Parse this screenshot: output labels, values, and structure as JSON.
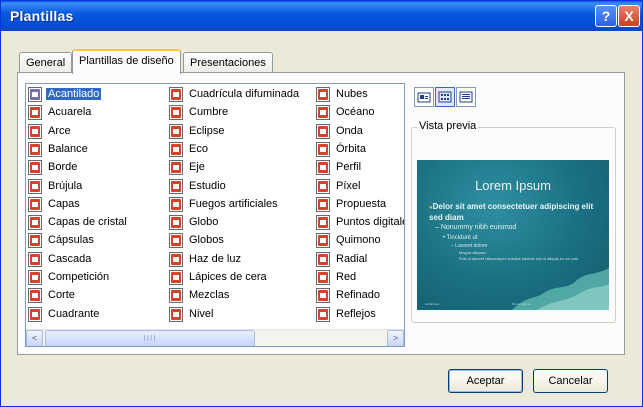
{
  "window": {
    "title": "Plantillas",
    "help_label": "?",
    "close_label": "X"
  },
  "tabs": [
    {
      "label": "General",
      "active": false
    },
    {
      "label": "Plantillas de diseño",
      "active": true
    },
    {
      "label": "Presentaciones",
      "active": false
    }
  ],
  "templates": {
    "columns": [
      [
        "Acantilado",
        "Acuarela",
        "Arce",
        "Balance",
        "Borde",
        "Brújula",
        "Capas",
        "Capas de cristal",
        "Cápsulas",
        "Cascada",
        "Competición",
        "Corte",
        "Cuadrante"
      ],
      [
        "Cuadrícula difuminada",
        "Cumbre",
        "Eclipse",
        "Eco",
        "Eje",
        "Estudio",
        "Fuegos artificiales",
        "Globo",
        "Globos",
        "Haz de luz",
        "Lápices de cera",
        "Mezclas",
        "Nivel"
      ],
      [
        "Nubes",
        "Océano",
        "Onda",
        "Órbita",
        "Perfil",
        "Píxel",
        "Propuesta",
        "Puntos digitale",
        "Quimono",
        "Radial",
        "Red",
        "Refinado",
        "Reflejos"
      ]
    ],
    "selected": "Acantilado",
    "icon": "template-icon"
  },
  "scrollbar": {
    "left_label": "<",
    "right_label": ">",
    "thumb_grip": "IIII"
  },
  "view_buttons": [
    {
      "icon": "large-icons-view-icon",
      "active": false
    },
    {
      "icon": "list-view-icon",
      "active": true
    },
    {
      "icon": "details-view-icon",
      "active": false
    }
  ],
  "preview": {
    "label": "Vista previa",
    "slide_title": "Lorem Ipsum",
    "bullets": [
      "Delor sit amet consectetuer adipiscing elit sed diam",
      "– Nonummy nibh euismod",
      "• Tincidunt ut",
      "– Laoreet dolore",
      "Magna aliquam",
      "Erat ut laoreet ullamcorper suscipit lobortis nisl ut aliquip ex ea com"
    ],
    "footer_left": "fecha/hora",
    "footer_right": "Pie de página"
  },
  "buttons": {
    "ok": "Aceptar",
    "cancel": "Cancelar"
  },
  "colors": {
    "titlebar": "#0a5fe8",
    "selection": "#316ac5",
    "slide_background": "#1a6f82",
    "dialog_background": "#ece9d8"
  }
}
